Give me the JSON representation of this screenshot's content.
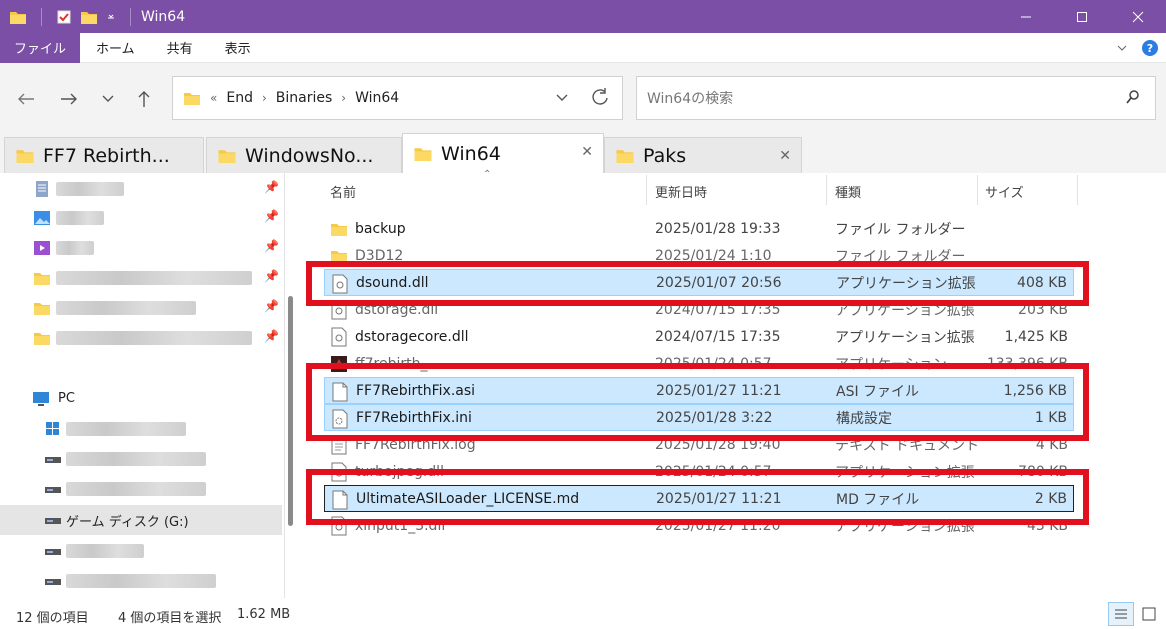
{
  "window": {
    "title": "Win64"
  },
  "ribbon": {
    "tabs": [
      "ファイル",
      "ホーム",
      "共有",
      "表示"
    ]
  },
  "address": {
    "crumbs": [
      "End",
      "Binaries",
      "Win64"
    ]
  },
  "search": {
    "placeholder": "Win64の検索"
  },
  "folder_tabs": [
    {
      "label": "FF7 Rebirth..."
    },
    {
      "label": "WindowsNo..."
    },
    {
      "label": "Win64"
    },
    {
      "label": "Paks"
    }
  ],
  "sidebar": {
    "pc_label": "PC",
    "drive_label": "ゲーム ディスク (G:)"
  },
  "columns": {
    "name": "名前",
    "date": "更新日時",
    "type": "種類",
    "size": "サイズ"
  },
  "files": [
    {
      "name": "backup",
      "date": "2025/01/28 19:33",
      "type": "ファイル フォルダー",
      "size": ""
    },
    {
      "name": "D3D12",
      "date": "2025/01/24 1:10",
      "type": "ファイル フォルダー",
      "size": ""
    },
    {
      "name": "dsound.dll",
      "date": "2025/01/07 20:56",
      "type": "アプリケーション拡張",
      "size": "408 KB"
    },
    {
      "name": "dstorage.dll",
      "date": "2024/07/15 17:35",
      "type": "アプリケーション拡張",
      "size": "203 KB"
    },
    {
      "name": "dstoragecore.dll",
      "date": "2024/07/15 17:35",
      "type": "アプリケーション拡張",
      "size": "1,425 KB"
    },
    {
      "name": "ff7rebirth_",
      "date": "2025/01/24 0:57",
      "type": "アプリケーション",
      "size": "133,396 KB"
    },
    {
      "name": "FF7RebirthFix.asi",
      "date": "2025/01/27 11:21",
      "type": "ASI ファイル",
      "size": "1,256 KB"
    },
    {
      "name": "FF7RebirthFix.ini",
      "date": "2025/01/28 3:22",
      "type": "構成設定",
      "size": "1 KB"
    },
    {
      "name": "FF7RebirthFix.log",
      "date": "2025/01/28 19:40",
      "type": "テキスト ドキュメント",
      "size": "4 KB"
    },
    {
      "name": "turbojpeg.dll",
      "date": "2025/01/24 0:57",
      "type": "アプリケーション拡張",
      "size": "780 KB"
    },
    {
      "name": "UltimateASILoader_LICENSE.md",
      "date": "2025/01/27 11:21",
      "type": "MD ファイル",
      "size": "2 KB"
    },
    {
      "name": "xinput1_3.dll",
      "date": "2025/01/27 11:20",
      "type": "アプリケーション拡張",
      "size": "43 KB"
    }
  ],
  "status": {
    "count": "12 個の項目",
    "selection": "4 個の項目を選択",
    "size": "1.62 MB"
  },
  "colors": {
    "titlebar": "#7a4fa5",
    "selection": "#cce8ff",
    "highlight": "#e0101e"
  }
}
